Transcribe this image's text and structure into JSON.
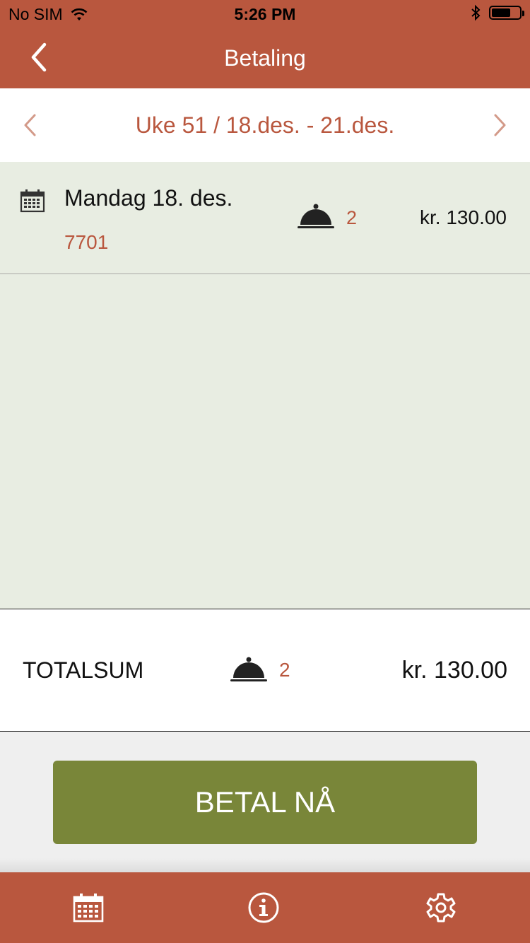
{
  "status_bar": {
    "carrier": "No SIM",
    "time": "5:26 PM"
  },
  "nav": {
    "title": "Betaling"
  },
  "week": {
    "label": "Uke 51 / 18.des. - 21.des."
  },
  "days": [
    {
      "title": "Mandag 18. des.",
      "code": "7701",
      "count": "2",
      "price": "kr. 130.00"
    }
  ],
  "total": {
    "label": "TOTALSUM",
    "count": "2",
    "price": "kr. 130.00"
  },
  "pay_button": {
    "label": "BETAL NÅ"
  },
  "tabs": [
    {
      "icon": "calendar-icon"
    },
    {
      "icon": "info-icon"
    },
    {
      "icon": "gear-icon"
    }
  ],
  "colors": {
    "brand": "#b9573e",
    "content_bg": "#e8ede2",
    "pay_button": "#798639"
  }
}
